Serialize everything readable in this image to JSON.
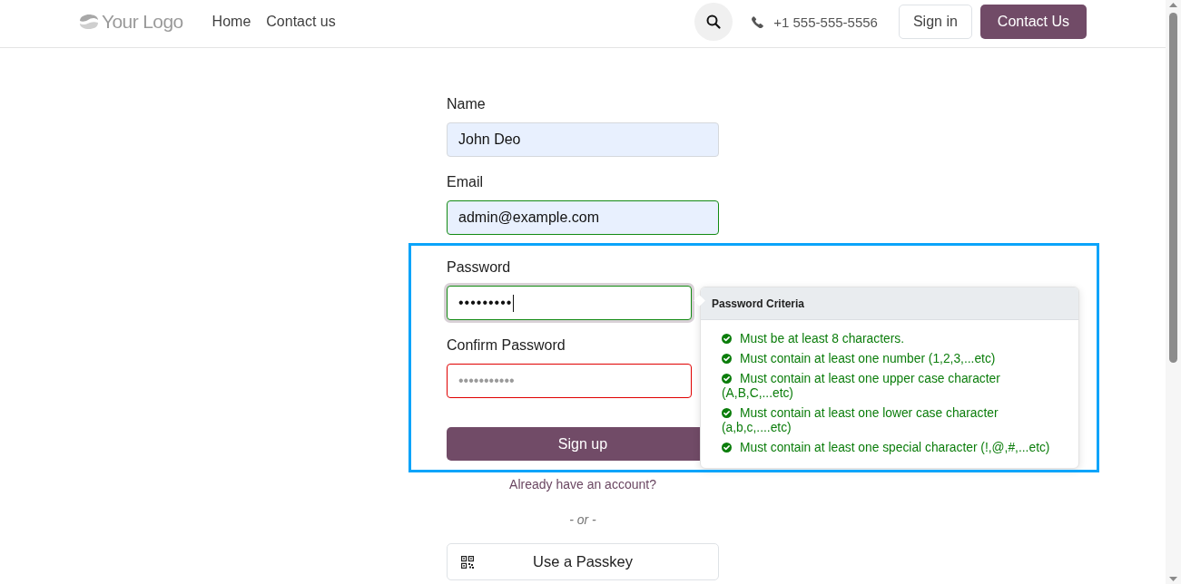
{
  "header": {
    "logo": "Your Logo",
    "nav": [
      {
        "label": "Home"
      },
      {
        "label": "Contact us"
      }
    ],
    "phone": "+1 555-555-5556",
    "sign_in": "Sign in",
    "contact_button": "Contact Us"
  },
  "form": {
    "fields": [
      {
        "kind": "text",
        "label": "Name",
        "value": "John Deo",
        "autofilled": true,
        "valid": false,
        "invalid": false,
        "focused": false
      },
      {
        "kind": "email",
        "label": "Email",
        "value": "admin@example.com",
        "autofilled": true,
        "valid": true,
        "invalid": false,
        "focused": false
      },
      {
        "kind": "password",
        "label": "Password",
        "value": "•••••••••",
        "autofilled": false,
        "valid": true,
        "invalid": false,
        "focused": true
      },
      {
        "kind": "password",
        "label": "Confirm Password",
        "placeholder": "•••••••••••",
        "autofilled": false,
        "valid": false,
        "invalid": true,
        "focused": false
      }
    ],
    "submit": "Sign up",
    "login_link": "Already have an account?",
    "separator": "- or -",
    "passkey_button": "Use a Passkey"
  },
  "criteria_popover": {
    "title": "Password Criteria",
    "items": [
      {
        "text": "Must be at least 8 characters.",
        "met": true
      },
      {
        "text": "Must contain at least one number (1,2,3,...etc)",
        "met": true
      },
      {
        "text": "Must contain at least one upper case character (A,B,C,...etc)",
        "met": true
      },
      {
        "text": "Must contain at least one lower case character (a,b,c,....etc)",
        "met": true
      },
      {
        "text": "Must contain at least one special character (!,@,#,...etc)",
        "met": true
      }
    ]
  }
}
